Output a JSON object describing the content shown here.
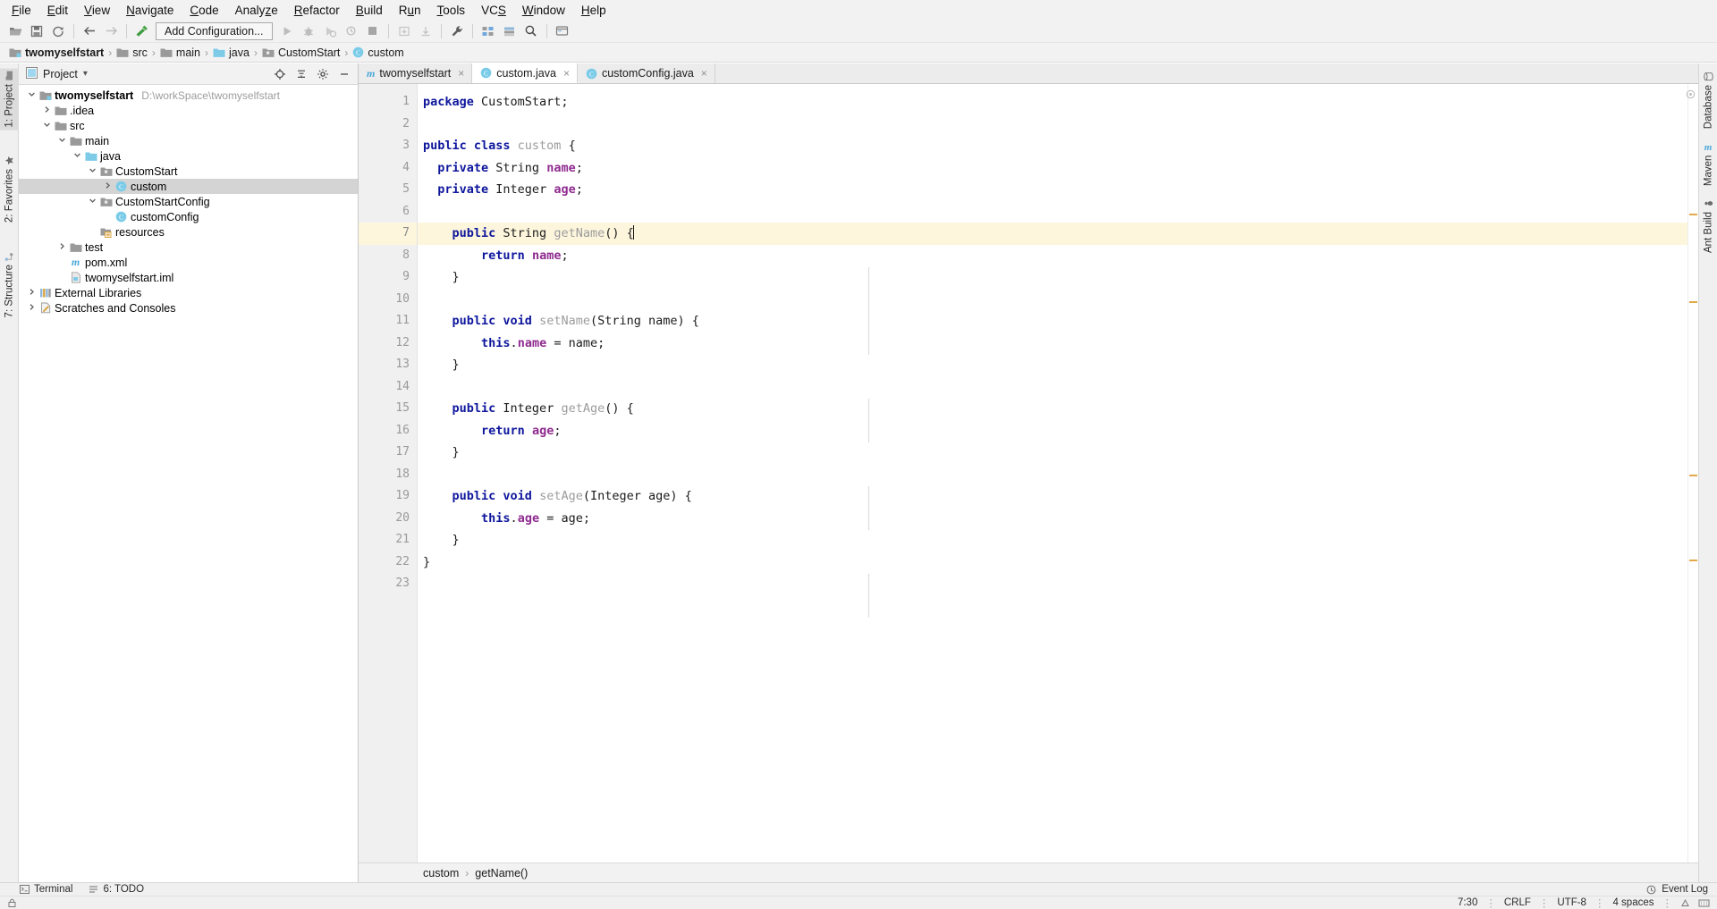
{
  "menubar": {
    "items": [
      {
        "label": "File",
        "mnemonic": "F"
      },
      {
        "label": "Edit",
        "mnemonic": "E"
      },
      {
        "label": "View",
        "mnemonic": "V"
      },
      {
        "label": "Navigate",
        "mnemonic": "N"
      },
      {
        "label": "Code",
        "mnemonic": "C"
      },
      {
        "label": "Analyze",
        "mnemonic": "z"
      },
      {
        "label": "Refactor",
        "mnemonic": "R"
      },
      {
        "label": "Build",
        "mnemonic": "B"
      },
      {
        "label": "Run",
        "mnemonic": "u"
      },
      {
        "label": "Tools",
        "mnemonic": "T"
      },
      {
        "label": "VCS",
        "mnemonic": "S"
      },
      {
        "label": "Window",
        "mnemonic": "W"
      },
      {
        "label": "Help",
        "mnemonic": "H"
      }
    ]
  },
  "toolbar": {
    "run_config_label": "Add Configuration...",
    "icons": [
      "open-folder-icon",
      "save-all-icon",
      "sync-refresh-icon",
      "back-arrow-icon",
      "forward-arrow-icon",
      "build-hammer-icon",
      "run-icon",
      "debug-icon",
      "run-with-coverage-icon",
      "profile-icon",
      "stop-icon",
      "update-project-icon",
      "commit-icon",
      "settings-wrench-icon",
      "project-structure-icon",
      "sdk-manager-icon",
      "search-everywhere-icon",
      "help-topics-icon"
    ]
  },
  "navbar": {
    "crumbs": [
      {
        "label": "twomyselfstart",
        "icon": "module-folder-icon",
        "bold": true
      },
      {
        "label": "src",
        "icon": "folder-icon",
        "bold": false
      },
      {
        "label": "main",
        "icon": "folder-icon",
        "bold": false
      },
      {
        "label": "java",
        "icon": "source-folder-icon",
        "bold": false
      },
      {
        "label": "CustomStart",
        "icon": "package-icon",
        "bold": false
      },
      {
        "label": "custom",
        "icon": "class-icon",
        "bold": false
      }
    ],
    "separator": "›"
  },
  "left_strip": {
    "items": [
      {
        "label": "1: Project",
        "selected": true
      },
      {
        "label": "2: Favorites",
        "selected": false
      },
      {
        "label": "7: Structure",
        "selected": false
      }
    ]
  },
  "right_strip": {
    "items": [
      {
        "label": "Database",
        "selected": false
      },
      {
        "label": "Maven",
        "selected": false
      },
      {
        "label": "Ant Build",
        "selected": false
      }
    ]
  },
  "project_panel": {
    "title": "Project",
    "dropdown_glyph": "▾",
    "header_icons": [
      "locate-target-icon",
      "collapse-all-icon",
      "gear-icon",
      "hide-minus-icon"
    ],
    "tree": [
      {
        "depth": 0,
        "arrow": "down",
        "icon": "module-folder-icon",
        "label": "twomyselfstart",
        "bold": true,
        "path": "D:\\workSpace\\twomyselfstart",
        "selected": false
      },
      {
        "depth": 1,
        "arrow": "right",
        "icon": "folder-icon",
        "label": ".idea",
        "bold": false,
        "path": "",
        "selected": false
      },
      {
        "depth": 1,
        "arrow": "down",
        "icon": "folder-icon",
        "label": "src",
        "bold": false,
        "path": "",
        "selected": false
      },
      {
        "depth": 2,
        "arrow": "down",
        "icon": "folder-icon",
        "label": "main",
        "bold": false,
        "path": "",
        "selected": false
      },
      {
        "depth": 3,
        "arrow": "down",
        "icon": "source-folder-icon",
        "label": "java",
        "bold": false,
        "path": "",
        "selected": false
      },
      {
        "depth": 4,
        "arrow": "down",
        "icon": "package-icon",
        "label": "CustomStart",
        "bold": false,
        "path": "",
        "selected": false
      },
      {
        "depth": 5,
        "arrow": "right",
        "icon": "class-icon",
        "label": "custom",
        "bold": false,
        "path": "",
        "selected": true
      },
      {
        "depth": 4,
        "arrow": "down",
        "icon": "package-icon",
        "label": "CustomStartConfig",
        "bold": false,
        "path": "",
        "selected": false
      },
      {
        "depth": 5,
        "arrow": "none",
        "icon": "class-icon",
        "label": "customConfig",
        "bold": false,
        "path": "",
        "selected": false
      },
      {
        "depth": 4,
        "arrow": "none",
        "icon": "resource-folder-icon",
        "label": "resources",
        "bold": false,
        "path": "",
        "selected": false
      },
      {
        "depth": 2,
        "arrow": "right",
        "icon": "folder-icon",
        "label": "test",
        "bold": false,
        "path": "",
        "selected": false
      },
      {
        "depth": 2,
        "arrow": "none",
        "icon": "maven-pom-icon",
        "label": "pom.xml",
        "bold": false,
        "path": "",
        "selected": false
      },
      {
        "depth": 2,
        "arrow": "none",
        "icon": "iml-file-icon",
        "label": "twomyselfstart.iml",
        "bold": false,
        "path": "",
        "selected": false
      },
      {
        "depth": 0,
        "arrow": "right",
        "icon": "libraries-icon",
        "label": "External Libraries",
        "bold": false,
        "path": "",
        "selected": false
      },
      {
        "depth": 0,
        "arrow": "right",
        "icon": "scratches-icon",
        "label": "Scratches and Consoles",
        "bold": false,
        "path": "",
        "selected": false
      }
    ]
  },
  "editor": {
    "tabs": [
      {
        "label": "twomyselfstart",
        "icon": "maven-pom-icon",
        "active": false,
        "close": "×"
      },
      {
        "label": "custom.java",
        "icon": "class-icon",
        "active": true,
        "close": "×"
      },
      {
        "label": "customConfig.java",
        "icon": "class-icon",
        "active": false,
        "close": "×"
      }
    ],
    "current_line": 7,
    "line_count": 23,
    "lines": [
      {
        "n": 1,
        "tokens": [
          {
            "t": "package ",
            "c": "k"
          },
          {
            "t": "CustomStart;",
            "c": "pl"
          }
        ]
      },
      {
        "n": 2,
        "tokens": []
      },
      {
        "n": 3,
        "tokens": [
          {
            "t": "public class ",
            "c": "k"
          },
          {
            "t": "custom",
            "c": "mn"
          },
          {
            "t": " {",
            "c": "pl"
          }
        ]
      },
      {
        "n": 4,
        "tokens": [
          {
            "t": "  ",
            "c": "pl"
          },
          {
            "t": "private ",
            "c": "k"
          },
          {
            "t": "String ",
            "c": "ty"
          },
          {
            "t": "name",
            "c": "fd"
          },
          {
            "t": ";",
            "c": "pl"
          }
        ]
      },
      {
        "n": 5,
        "tokens": [
          {
            "t": "  ",
            "c": "pl"
          },
          {
            "t": "private ",
            "c": "k"
          },
          {
            "t": "Integer ",
            "c": "ty"
          },
          {
            "t": "age",
            "c": "fd"
          },
          {
            "t": ";",
            "c": "pl"
          }
        ]
      },
      {
        "n": 6,
        "tokens": []
      },
      {
        "n": 7,
        "tokens": [
          {
            "t": "    ",
            "c": "pl"
          },
          {
            "t": "public ",
            "c": "k"
          },
          {
            "t": "String ",
            "c": "ty"
          },
          {
            "t": "getName",
            "c": "mn"
          },
          {
            "t": "() ",
            "c": "pl"
          },
          {
            "t": "{",
            "c": "pl",
            "caret": true
          }
        ]
      },
      {
        "n": 8,
        "tokens": [
          {
            "t": "        ",
            "c": "pl"
          },
          {
            "t": "return ",
            "c": "k"
          },
          {
            "t": "name",
            "c": "fd"
          },
          {
            "t": ";",
            "c": "pl"
          }
        ]
      },
      {
        "n": 9,
        "tokens": [
          {
            "t": "    }",
            "c": "pl"
          }
        ]
      },
      {
        "n": 10,
        "tokens": []
      },
      {
        "n": 11,
        "tokens": [
          {
            "t": "    ",
            "c": "pl"
          },
          {
            "t": "public void ",
            "c": "k"
          },
          {
            "t": "setName",
            "c": "mn"
          },
          {
            "t": "(String name) {",
            "c": "pl"
          }
        ]
      },
      {
        "n": 12,
        "tokens": [
          {
            "t": "        ",
            "c": "pl"
          },
          {
            "t": "this",
            "c": "k"
          },
          {
            "t": ".",
            "c": "pl"
          },
          {
            "t": "name",
            "c": "fd"
          },
          {
            "t": " = name;",
            "c": "pl"
          }
        ]
      },
      {
        "n": 13,
        "tokens": [
          {
            "t": "    }",
            "c": "pl"
          }
        ]
      },
      {
        "n": 14,
        "tokens": []
      },
      {
        "n": 15,
        "tokens": [
          {
            "t": "    ",
            "c": "pl"
          },
          {
            "t": "public ",
            "c": "k"
          },
          {
            "t": "Integer ",
            "c": "ty"
          },
          {
            "t": "getAge",
            "c": "mn"
          },
          {
            "t": "() {",
            "c": "pl"
          }
        ]
      },
      {
        "n": 16,
        "tokens": [
          {
            "t": "        ",
            "c": "pl"
          },
          {
            "t": "return ",
            "c": "k"
          },
          {
            "t": "age",
            "c": "fd"
          },
          {
            "t": ";",
            "c": "pl"
          }
        ]
      },
      {
        "n": 17,
        "tokens": [
          {
            "t": "    }",
            "c": "pl"
          }
        ]
      },
      {
        "n": 18,
        "tokens": []
      },
      {
        "n": 19,
        "tokens": [
          {
            "t": "    ",
            "c": "pl"
          },
          {
            "t": "public void ",
            "c": "k"
          },
          {
            "t": "setAge",
            "c": "mn"
          },
          {
            "t": "(Integer age) {",
            "c": "pl"
          }
        ]
      },
      {
        "n": 20,
        "tokens": [
          {
            "t": "        ",
            "c": "pl"
          },
          {
            "t": "this",
            "c": "k"
          },
          {
            "t": ".",
            "c": "pl"
          },
          {
            "t": "age",
            "c": "fd"
          },
          {
            "t": " = age;",
            "c": "pl"
          }
        ]
      },
      {
        "n": 21,
        "tokens": [
          {
            "t": "    }",
            "c": "pl"
          }
        ]
      },
      {
        "n": 22,
        "tokens": [
          {
            "t": "}",
            "c": "pl"
          }
        ]
      },
      {
        "n": 23,
        "tokens": []
      }
    ],
    "markers": [
      7,
      15,
      19,
      24,
      30
    ],
    "breadcrumb": {
      "parts": [
        "custom",
        "getName()"
      ],
      "separator": "›"
    }
  },
  "bottom_bar": {
    "items": [
      {
        "label": "Terminal",
        "icon": "terminal-icon"
      },
      {
        "label": "6: TODO",
        "icon": "todo-icon"
      }
    ],
    "event_log": {
      "label": "Event Log",
      "icon": "event-log-icon"
    }
  },
  "status_bar": {
    "caret": "7:30",
    "line_separator": "CRLF",
    "encoding": "UTF-8",
    "indent": "4 spaces",
    "separator": "⋮",
    "icons": [
      "lock-icon",
      "inspections-icon",
      "memory-icon"
    ]
  },
  "colors": {
    "keyword": "#0e169c",
    "field": "#8f2b8f",
    "method": "#9c9c9c",
    "current_line_bg": "#fdf6dd",
    "selection_bg": "#d4d4d4",
    "chrome_bg": "#f2f2f2",
    "accent_cyan": "#79cbe8",
    "marker_orange": "#e2a94a"
  }
}
